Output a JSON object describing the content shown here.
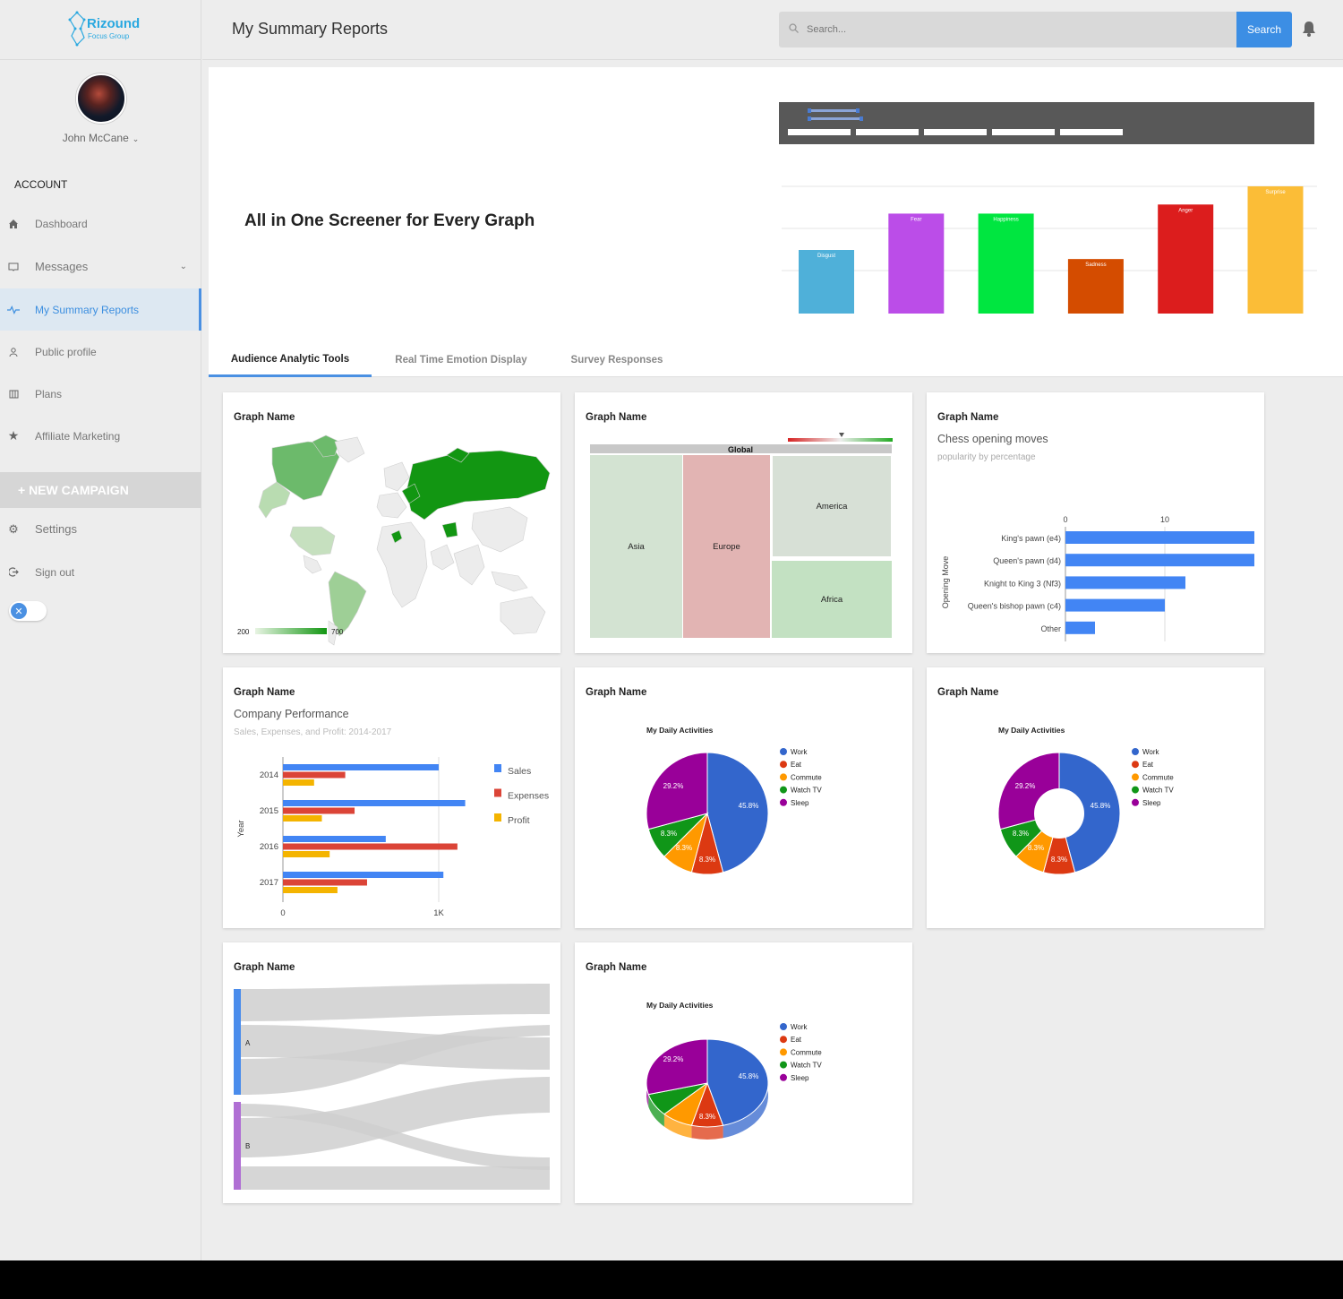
{
  "brand": {
    "name": "Rizound",
    "tagline": "Focus Group"
  },
  "user": {
    "name": "John McCane"
  },
  "sidebar": {
    "section": "ACCOUNT",
    "items": [
      {
        "label": "Dashboard",
        "icon": "home-icon"
      },
      {
        "label": "Messages",
        "icon": "inbox-icon"
      },
      {
        "label": "My Summary Reports",
        "icon": "pulse-icon"
      },
      {
        "label": "Public profile",
        "icon": "user-icon"
      },
      {
        "label": "Plans",
        "icon": "plans-icon"
      },
      {
        "label": "Affiliate Marketing",
        "icon": "star-icon"
      }
    ],
    "new_campaign": "+ NEW CAMPAIGN",
    "settings": "Settings",
    "signout": "Sign out"
  },
  "header": {
    "title": "My Summary Reports",
    "search_placeholder": "Search...",
    "search_button": "Search"
  },
  "banner": {
    "title": "All in One Screener for Every Graph"
  },
  "tabs": [
    "Audience Analytic Tools",
    "Real Time Emotion Display",
    "Survey Responses"
  ],
  "cards": {
    "graph_name": "Graph Name"
  },
  "colors": {
    "accent": "#3c8ee4",
    "sales": "#4285f4",
    "expenses": "#db4437",
    "profit": "#f4b400"
  },
  "chart_data": [
    {
      "type": "bar",
      "categories": [
        "Disgust",
        "Fear",
        "Happiness",
        "Sadness",
        "Anger",
        "Surprise"
      ],
      "values": [
        3.5,
        5.5,
        5.5,
        3.0,
        6.0,
        7.0
      ],
      "colors": [
        "#4fb0d9",
        "#bb4de8",
        "#00e640",
        "#d44c00",
        "#dc1d1d",
        "#fbbd37"
      ]
    },
    {
      "type": "heatmap",
      "subtype": "geochart",
      "colorbar": {
        "min": "200",
        "max": "700"
      }
    },
    {
      "type": "heatmap",
      "subtype": "treemap",
      "root": "Global",
      "nodes": [
        "Asia",
        "Europe",
        "America",
        "Africa"
      ]
    },
    {
      "type": "bar",
      "orientation": "horizontal",
      "title": "Chess opening moves",
      "subtitle": "popularity by percentage",
      "ylabel": "Opening Move",
      "categories": [
        "King's pawn (e4)",
        "Queen's pawn (d4)",
        "Knight to King 3 (Nf3)",
        "Queen's bishop pawn (c4)",
        "Other"
      ],
      "values": [
        44,
        31,
        12,
        10,
        3
      ],
      "xticks": [
        "0",
        "10"
      ],
      "xlim": [
        0,
        12
      ]
    },
    {
      "type": "bar",
      "orientation": "horizontal",
      "title": "Company Performance",
      "subtitle": "Sales, Expenses, and Profit: 2014-2017",
      "ylabel": "Year",
      "categories": [
        "2014",
        "2015",
        "2016",
        "2017"
      ],
      "series": [
        {
          "name": "Sales",
          "values": [
            1000,
            1170,
            660,
            1030
          ]
        },
        {
          "name": "Expenses",
          "values": [
            400,
            460,
            1120,
            540
          ]
        },
        {
          "name": "Profit",
          "values": [
            200,
            250,
            300,
            350
          ]
        }
      ],
      "xticks": [
        "0",
        "1K"
      ],
      "xlim": [
        0,
        1000
      ]
    },
    {
      "type": "pie",
      "title": "My Daily Activities",
      "labels": [
        "Work",
        "Eat",
        "Commute",
        "Watch TV",
        "Sleep"
      ],
      "values": [
        11,
        2,
        2,
        2,
        7
      ],
      "slice_labels": [
        "45.8%",
        "8.3%",
        "8.3%",
        "8.3%",
        "29.2%"
      ]
    },
    {
      "type": "pie",
      "subtype": "donut",
      "title": "My Daily Activities",
      "labels": [
        "Work",
        "Eat",
        "Commute",
        "Watch TV",
        "Sleep"
      ],
      "values": [
        11,
        2,
        2,
        2,
        7
      ],
      "slice_labels": [
        "45.8%",
        "8.3%",
        "8.3%",
        "8.3%",
        "29.2%"
      ]
    },
    {
      "type": "other",
      "subtype": "sankey",
      "nodes": [
        "A",
        "B"
      ]
    },
    {
      "type": "pie",
      "subtype": "3d",
      "title": "My Daily Activities",
      "labels": [
        "Work",
        "Eat",
        "Commute",
        "Watch TV",
        "Sleep"
      ],
      "values": [
        11,
        2,
        2,
        2,
        7
      ],
      "slice_labels": [
        "45.8%",
        "8.3%",
        "29.2%"
      ]
    }
  ]
}
